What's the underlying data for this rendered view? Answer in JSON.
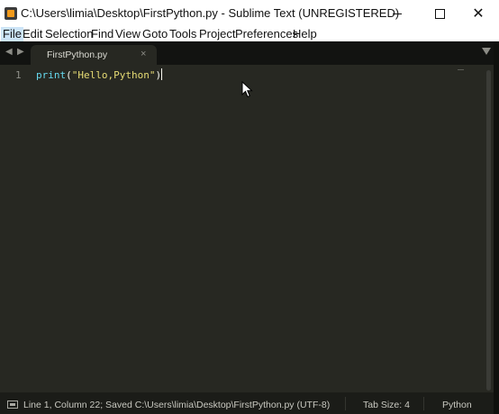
{
  "window": {
    "title": "C:\\Users\\limia\\Desktop\\FirstPython.py - Sublime Text (UNREGISTERED)",
    "minimize_glyph": "",
    "close_glyph": "✕"
  },
  "menu": {
    "items": [
      "File",
      "Edit",
      "Selection",
      "Find",
      "View",
      "Goto",
      "Tools",
      "Project",
      "Preferences",
      "Help"
    ],
    "active": "File"
  },
  "tabs": {
    "nav_left": "◀",
    "nav_right": "▶",
    "items": [
      {
        "label": "FirstPython.py",
        "close": "×"
      }
    ]
  },
  "editor": {
    "line_numbers": [
      "1"
    ],
    "code": {
      "fn": "print",
      "open": "(",
      "str": "\"Hello,Python\"",
      "close": ")"
    }
  },
  "statusbar": {
    "position_text": "Line 1, Column 22; Saved C:\\Users\\limia\\Desktop\\FirstPython.py (UTF-8)",
    "tab_size": "Tab Size: 4",
    "syntax": "Python"
  },
  "colors": {
    "editor_bg": "#272822",
    "keyword": "#66d9ef",
    "string": "#e6db74",
    "text": "#f8f8f2"
  }
}
